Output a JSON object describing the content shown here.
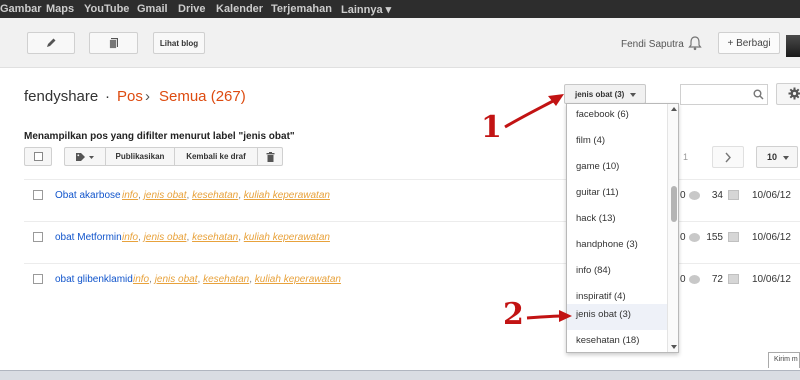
{
  "google_bar": {
    "items": [
      "Gambar",
      "Maps",
      "YouTube",
      "Gmail",
      "Drive",
      "Kalender",
      "Terjemahan",
      "Lainnya ▾"
    ]
  },
  "toolbar": {
    "view_blog_label": "Lihat blog",
    "user_name": "Fendi Saputra",
    "share_label": "+ Berbagi"
  },
  "header": {
    "blog_name": "fendyshare",
    "sep": "·",
    "section": "Pos",
    "arrow": "›",
    "filter_label": "Semua (267)"
  },
  "label_filter": {
    "selected": "jenis obat (3)"
  },
  "filter_note": "Menampilkan pos yang difilter menurut label \"jenis obat\"",
  "actions": {
    "publish": "Publikasikan",
    "revert_draft": "Kembali ke draf"
  },
  "pager": {
    "page": "1",
    "per_page": "10"
  },
  "posts": [
    {
      "title": "Obat akarbose",
      "labels": [
        "info",
        "jenis obat",
        "kesehatan",
        "kuliah keperawatan"
      ],
      "comments": "0",
      "views": "34",
      "date": "10/06/12"
    },
    {
      "title": "obat Metformin",
      "labels": [
        "info",
        "jenis obat",
        "kesehatan",
        "kuliah keperawatan"
      ],
      "comments": "0",
      "views": "155",
      "date": "10/06/12"
    },
    {
      "title": "obat glibenklamid",
      "labels": [
        "info",
        "jenis obat",
        "kesehatan",
        "kuliah keperawatan"
      ],
      "comments": "0",
      "views": "72",
      "date": "10/06/12"
    }
  ],
  "dropdown": {
    "options": [
      "facebook (6)",
      "film (4)",
      "game (10)",
      "guitar (11)",
      "hack (13)",
      "handphone (3)",
      "info (84)",
      "inspiratif (4)",
      "jenis obat (3)",
      "kesehatan (18)"
    ],
    "selected_index": 8
  },
  "annotations": {
    "one": "1",
    "two": "2",
    "color": "#c21313"
  },
  "chat_tab": "Kirim m",
  "colors": {
    "accent": "#dd4b10",
    "link": "#1155cc",
    "label": "#e8a23c",
    "topbar": "#2d2d2d"
  }
}
